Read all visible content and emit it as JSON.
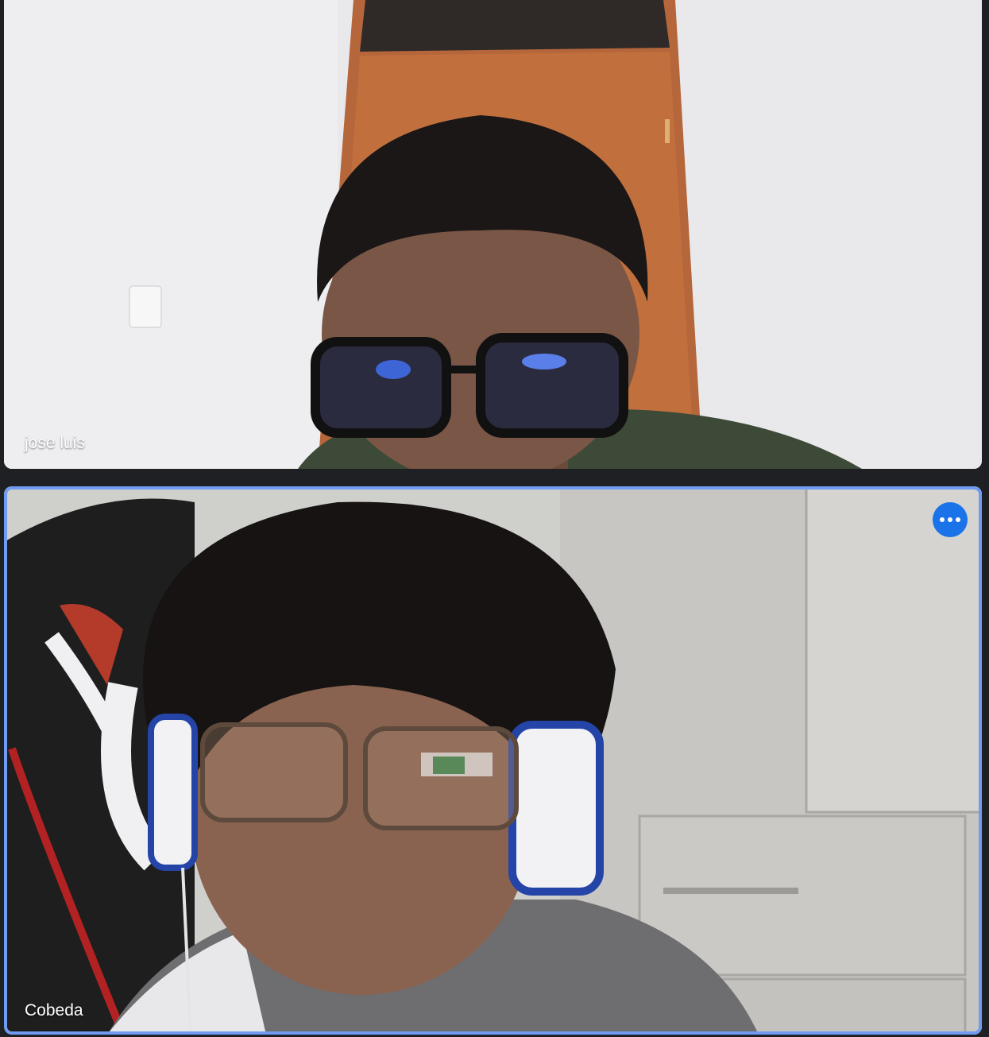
{
  "participants": [
    {
      "name": "jose luis",
      "active_speaker": false
    },
    {
      "name": "Cobeda",
      "active_speaker": true
    }
  ],
  "controls": {
    "more_options_icon": "more-horizontal-icon"
  },
  "colors": {
    "background": "#1f2023",
    "active_border": "#6f9bf2",
    "more_button": "#1a73e8"
  }
}
